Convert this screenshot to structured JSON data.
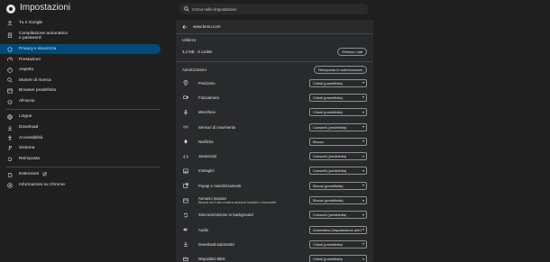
{
  "app": {
    "title": "Impostazioni"
  },
  "search": {
    "placeholder": "Cerca nelle impostazioni"
  },
  "sidebar": {
    "items": [
      {
        "label": "Tu e Google",
        "icon": "person-icon"
      },
      {
        "label": "Compilazione automatica e password",
        "icon": "clipboard-icon"
      },
      {
        "label": "Privacy e sicurezza",
        "icon": "shield-icon",
        "active": true
      },
      {
        "label": "Prestazioni",
        "icon": "speedometer-icon"
      },
      {
        "label": "Aspetto",
        "icon": "palette-icon"
      },
      {
        "label": "Motore di ricerca",
        "icon": "search-icon"
      },
      {
        "label": "Browser predefinito",
        "icon": "browser-icon"
      },
      {
        "label": "All'avvio",
        "icon": "power-icon"
      },
      {
        "label": "Lingue",
        "icon": "globe-icon"
      },
      {
        "label": "Download",
        "icon": "download-icon"
      },
      {
        "label": "Accessibilità",
        "icon": "accessibility-icon"
      },
      {
        "label": "Sistema",
        "icon": "wrench-icon"
      },
      {
        "label": "Reimposta",
        "icon": "reset-icon"
      },
      {
        "label": "Estensioni",
        "icon": "puzzle-icon"
      },
      {
        "label": "Informazioni su Chrome",
        "icon": "chrome-icon"
      }
    ]
  },
  "site": {
    "host": "www.benu.com",
    "usage_title": "Utilizzo",
    "usage_text": "3,4 MB · 6 cookie",
    "clear_label": "Elimina i dati",
    "permissions_title": "Autorizzazioni",
    "reset_label": "Reimposta le autorizzazioni"
  },
  "permissions": [
    {
      "label": "Posizione",
      "icon": "location-icon",
      "value": "Chiedi (predefinita)"
    },
    {
      "label": "Fotocamera",
      "icon": "camera-icon",
      "value": "Chiedi (predefinita)"
    },
    {
      "label": "Microfono",
      "icon": "microphone-icon",
      "value": "Chiedi (predefinita)"
    },
    {
      "label": "Sensori di movimento",
      "icon": "sensors-icon",
      "value": "Consenti (predefinita)"
    },
    {
      "label": "Notifiche",
      "icon": "bell-icon",
      "value": "Blocca"
    },
    {
      "label": "JavaScript",
      "icon": "code-icon",
      "value": "Consenti (predefinita)"
    },
    {
      "label": "Immagini",
      "icon": "image-icon",
      "value": "Consenti (predefinita)"
    },
    {
      "label": "Popup e reindirizzamenti",
      "icon": "popup-icon",
      "value": "Blocca (predefinita)"
    },
    {
      "label": "Annunci invasivi",
      "sub": "Blocca se il sito mostra annunci invasivi o fuorvianti",
      "icon": "ads-icon",
      "value": "Blocca (predefinita)"
    },
    {
      "label": "Sincronizzazione in background",
      "icon": "sync-icon",
      "value": "Consenti (predefinita)"
    },
    {
      "label": "Audio",
      "icon": "speaker-icon",
      "value": "Automatica (impostazione pred"
    },
    {
      "label": "Download automatici",
      "icon": "download-icon",
      "value": "Chiedi (predefinita)"
    },
    {
      "label": "Dispositivi MIDI",
      "icon": "midi-icon",
      "value": "Chiedi (predefinita)"
    }
  ],
  "colors": {
    "background": "#1f1f1f",
    "panel": "#282a2c",
    "accent": "#004a77",
    "accent_text": "#c2e7ff"
  }
}
